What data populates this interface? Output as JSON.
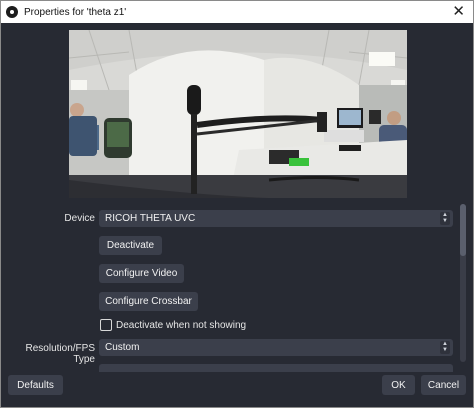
{
  "window": {
    "title": "Properties for 'theta z1'"
  },
  "preview": {
    "description_icon": "camera-preview"
  },
  "device": {
    "label": "Device",
    "value": "RICOH THETA UVC"
  },
  "buttons": {
    "deactivate": "Deactivate",
    "configure_video": "Configure Video",
    "configure_crossbar": "Configure Crossbar"
  },
  "checkbox": {
    "label": "Deactivate when not showing",
    "checked": false
  },
  "resolution": {
    "label": "Resolution/FPS Type",
    "value": "Custom"
  },
  "footer": {
    "defaults": "Defaults",
    "ok": "OK",
    "cancel": "Cancel"
  },
  "colors": {
    "background": "#272a33",
    "control": "#3b3f4b",
    "text": "#e6e6e6"
  }
}
